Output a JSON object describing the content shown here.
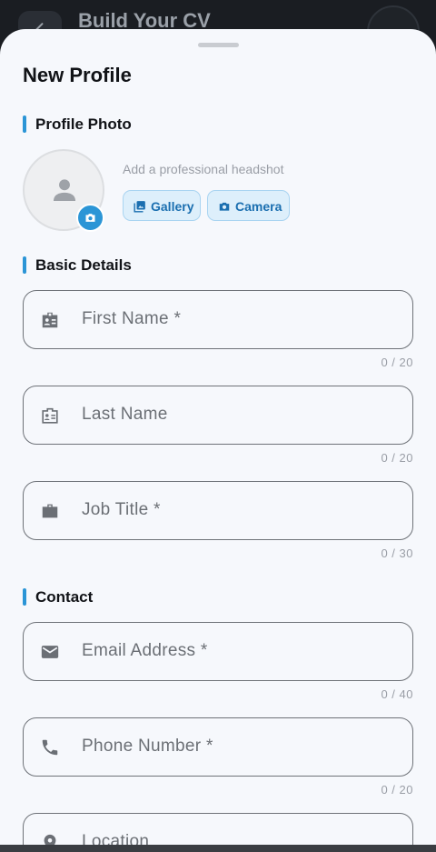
{
  "app_bar": {
    "title": "Build Your CV"
  },
  "sheet": {
    "title": "New Profile"
  },
  "profile_photo": {
    "section_label": "Profile Photo",
    "hint": "Add a professional headshot",
    "gallery_label": "Gallery",
    "camera_label": "Camera"
  },
  "basic_details": {
    "section_label": "Basic Details",
    "fields": [
      {
        "placeholder": "First Name *",
        "counter": "0 / 20",
        "icon": "badge-icon"
      },
      {
        "placeholder": "Last Name",
        "counter": "0 / 20",
        "icon": "badge-outline-icon"
      },
      {
        "placeholder": "Job Title *",
        "counter": "0 / 30",
        "icon": "briefcase-icon"
      }
    ]
  },
  "contact": {
    "section_label": "Contact",
    "fields": [
      {
        "placeholder": "Email Address *",
        "counter": "0 / 40",
        "icon": "email-icon"
      },
      {
        "placeholder": "Phone Number *",
        "counter": "0 / 20",
        "icon": "phone-icon"
      },
      {
        "placeholder": "Location",
        "icon": "location-pin-icon"
      }
    ]
  },
  "colors": {
    "accent": "#2b95d6",
    "sheet_background": "#f6f8fc",
    "chip_background": "#ddeffb"
  }
}
